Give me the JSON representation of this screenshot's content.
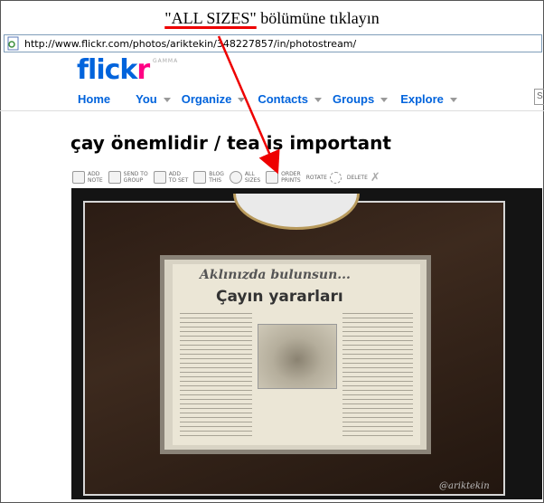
{
  "instruction": {
    "highlight": "\"ALL SIZES\"",
    "rest": " bölümüne tıklayın"
  },
  "browser": {
    "url": "http://www.flickr.com/photos/ariktekin/348227857/in/photostream/"
  },
  "logo": {
    "flick": "flick",
    "r": "r",
    "gamma": "GAMMA"
  },
  "nav": {
    "items": [
      {
        "label": "Home",
        "has_arrow": false
      },
      {
        "label": "You",
        "has_arrow": true
      },
      {
        "label": "Organize",
        "has_arrow": true
      },
      {
        "label": "Contacts",
        "has_arrow": true
      },
      {
        "label": "Groups",
        "has_arrow": true
      },
      {
        "label": "Explore",
        "has_arrow": true
      }
    ],
    "search_partial": "S"
  },
  "photo": {
    "title": "çay önemlidir / tea is important",
    "watermark": "@ariktekin"
  },
  "toolbar": {
    "add_note": [
      "ADD",
      "NOTE"
    ],
    "send_to_group": [
      "SEND TO",
      "GROUP"
    ],
    "add_to_set": [
      "ADD",
      "TO SET"
    ],
    "blog_this": [
      "BLOG",
      "THIS"
    ],
    "all_sizes": [
      "ALL",
      "SIZES"
    ],
    "order_prints": [
      "ORDER",
      "PRINTS"
    ],
    "rotate": "ROTATE",
    "delete": "DELETE"
  },
  "clipping": {
    "headline_top": "Aklınızda bulunsun...",
    "headline_main": "Çayın yararları"
  },
  "colors": {
    "brand_blue": "#0063dc",
    "brand_pink": "#ff0084",
    "annotation_red": "#ee0000"
  }
}
